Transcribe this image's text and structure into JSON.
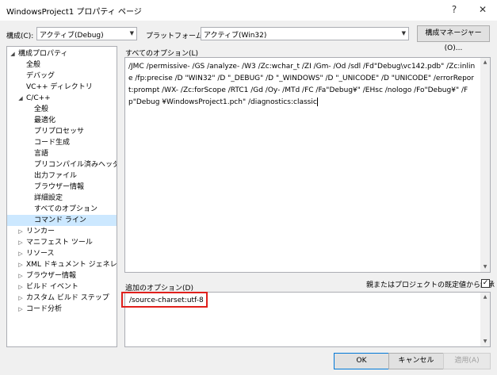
{
  "window": {
    "title": "WindowsProject1 プロパティ ページ",
    "help": "?",
    "close": "✕"
  },
  "toolbar": {
    "config_label": "構成(C):",
    "config_value": "アクティブ(Debug)",
    "platform_label": "プラットフォーム(P):",
    "platform_value": "アクティブ(Win32)",
    "config_manager": "構成マネージャー(O)..."
  },
  "tree": [
    {
      "label": "構成プロパティ",
      "exp": "◢",
      "level": 0
    },
    {
      "label": "全般",
      "exp": "",
      "level": 1
    },
    {
      "label": "デバッグ",
      "exp": "",
      "level": 1
    },
    {
      "label": "VC++ ディレクトリ",
      "exp": "",
      "level": 1
    },
    {
      "label": "C/C++",
      "exp": "◢",
      "level": 1
    },
    {
      "label": "全般",
      "exp": "",
      "level": 2
    },
    {
      "label": "最適化",
      "exp": "",
      "level": 2
    },
    {
      "label": "プリプロセッサ",
      "exp": "",
      "level": 2
    },
    {
      "label": "コード生成",
      "exp": "",
      "level": 2
    },
    {
      "label": "言語",
      "exp": "",
      "level": 2
    },
    {
      "label": "プリコンパイル済みヘッダー",
      "exp": "",
      "level": 2
    },
    {
      "label": "出力ファイル",
      "exp": "",
      "level": 2
    },
    {
      "label": "ブラウザー情報",
      "exp": "",
      "level": 2
    },
    {
      "label": "詳細設定",
      "exp": "",
      "level": 2
    },
    {
      "label": "すべてのオプション",
      "exp": "",
      "level": 2
    },
    {
      "label": "コマンド ライン",
      "exp": "",
      "level": 2,
      "selected": true
    },
    {
      "label": "リンカー",
      "exp": "▷",
      "level": 1
    },
    {
      "label": "マニフェスト ツール",
      "exp": "▷",
      "level": 1
    },
    {
      "label": "リソース",
      "exp": "▷",
      "level": 1
    },
    {
      "label": "XML ドキュメント ジェネレーター",
      "exp": "▷",
      "level": 1
    },
    {
      "label": "ブラウザー情報",
      "exp": "▷",
      "level": 1
    },
    {
      "label": "ビルド イベント",
      "exp": "▷",
      "level": 1
    },
    {
      "label": "カスタム ビルド ステップ",
      "exp": "▷",
      "level": 1
    },
    {
      "label": "コード分析",
      "exp": "▷",
      "level": 1
    }
  ],
  "all_options": {
    "label": "すべてのオプション(L)",
    "text": "/JMC /permissive- /GS /analyze- /W3 /Zc:wchar_t /ZI /Gm- /Od /sdl /Fd\"Debug\\vc142.pdb\" /Zc:inline /fp:precise /D \"WIN32\" /D \"_DEBUG\" /D \"_WINDOWS\" /D \"_UNICODE\" /D \"UNICODE\" /errorReport:prompt /WX- /Zc:forScope /RTC1 /Gd /Oy- /MTd /FC /Fa\"Debug¥\" /EHsc /nologo /Fo\"Debug¥\" /Fp\"Debug ¥WindowsProject1.pch\" /diagnostics:classic"
  },
  "additional": {
    "label": "追加のオプション(D)",
    "inherit_label": "親またはプロジェクトの既定値から継承",
    "inherit_checked": "✓",
    "value": "/source-charset:utf-8"
  },
  "buttons": {
    "ok": "OK",
    "cancel": "キャンセル",
    "apply": "適用(A)"
  }
}
